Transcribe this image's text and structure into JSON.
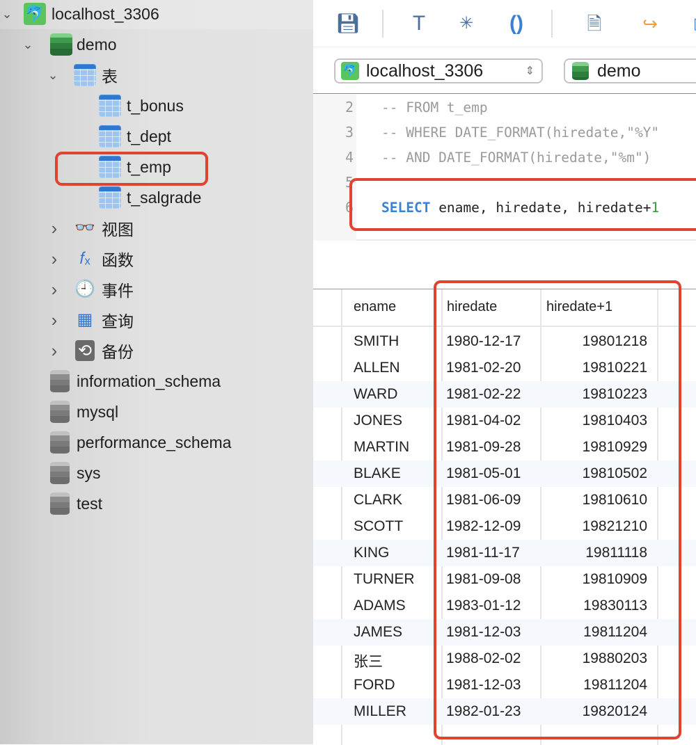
{
  "sidebar": {
    "connection": "localhost_3306",
    "database": "demo",
    "tables_group": "表",
    "tables": [
      "t_bonus",
      "t_dept",
      "t_emp",
      "t_salgrade"
    ],
    "groups": [
      {
        "label": "视图",
        "icon": "view-icon"
      },
      {
        "label": "函数",
        "icon": "function-icon"
      },
      {
        "label": "事件",
        "icon": "event-clock-icon"
      },
      {
        "label": "查询",
        "icon": "query-icon"
      },
      {
        "label": "备份",
        "icon": "backup-icon"
      }
    ],
    "other_databases": [
      "information_schema",
      "mysql",
      "performance_schema",
      "sys",
      "test"
    ],
    "highlighted_table": "t_emp"
  },
  "toolbar": {
    "icons": [
      "save-icon",
      "format-icon",
      "beautify-icon",
      "parentheses-icon",
      "document-icon",
      "export-icon"
    ]
  },
  "selectors": {
    "connection": "localhost_3306",
    "database": "demo"
  },
  "editor": {
    "lines": [
      {
        "n": "2",
        "text": "-- FROM t_emp"
      },
      {
        "n": "3",
        "text": "-- WHERE DATE_FORMAT(hiredate,\"%Y\""
      },
      {
        "n": "4",
        "text": "-- AND DATE_FORMAT(hiredate,\"%m\") "
      },
      {
        "n": "5",
        "text": ""
      },
      {
        "n": "6",
        "keyword": "SELECT",
        "text": " ename, hiredate, hiredate+",
        "num": "1"
      }
    ]
  },
  "results": {
    "columns": [
      "ename",
      "hiredate",
      "hiredate+1"
    ],
    "rows": [
      [
        "SMITH",
        "1980-12-17",
        "19801218"
      ],
      [
        "ALLEN",
        "1981-02-20",
        "19810221"
      ],
      [
        "WARD",
        "1981-02-22",
        "19810223"
      ],
      [
        "JONES",
        "1981-04-02",
        "19810403"
      ],
      [
        "MARTIN",
        "1981-09-28",
        "19810929"
      ],
      [
        "BLAKE",
        "1981-05-01",
        "19810502"
      ],
      [
        "CLARK",
        "1981-06-09",
        "19810610"
      ],
      [
        "SCOTT",
        "1982-12-09",
        "19821210"
      ],
      [
        "KING",
        "1981-11-17",
        "19811118"
      ],
      [
        "TURNER",
        "1981-09-08",
        "19810909"
      ],
      [
        "ADAMS",
        "1983-01-12",
        "19830113"
      ],
      [
        "JAMES",
        "1981-12-03",
        "19811204"
      ],
      [
        "张三",
        "1988-02-02",
        "19880203"
      ],
      [
        "FORD",
        "1981-12-03",
        "19811204"
      ],
      [
        "MILLER",
        "1982-01-23",
        "19820124"
      ]
    ]
  },
  "colors": {
    "highlight_box": "#e0432f",
    "keyword": "#3b82d6",
    "accent": "#3b7fd0"
  }
}
